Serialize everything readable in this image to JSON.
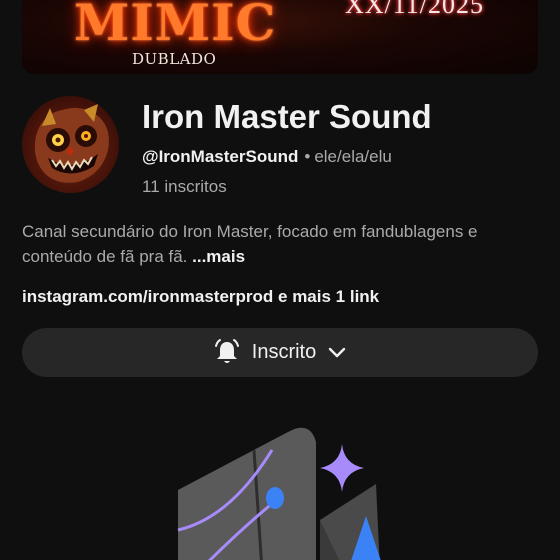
{
  "banner": {
    "title": "MIMIC",
    "subtitle": "DUBLADO",
    "date": "XX/11/2025"
  },
  "channel": {
    "name": "Iron Master Sound",
    "handle": "@IronMasterSound",
    "separator": "•",
    "pronouns": "ele/ela/elu",
    "subscribers": "11 inscritos"
  },
  "description": {
    "text": "Canal secundário do Iron Master, focado em fandublagens e conteúdo de fã pra fã.",
    "more_label": "...mais"
  },
  "links": {
    "primary": "instagram.com/ironmasterprod",
    "more": "e mais 1 link"
  },
  "subscribe_button": {
    "label": "Inscrito",
    "icons": [
      "bell-icon",
      "chevron-down-icon"
    ]
  },
  "colors": {
    "background": "#0f0f0f",
    "button_bg": "#272727",
    "secondary_text": "#aaaaaa",
    "primary_text": "#f1f1f1",
    "illustration_purple": "#a78bfa",
    "illustration_blue": "#3b82f6"
  }
}
